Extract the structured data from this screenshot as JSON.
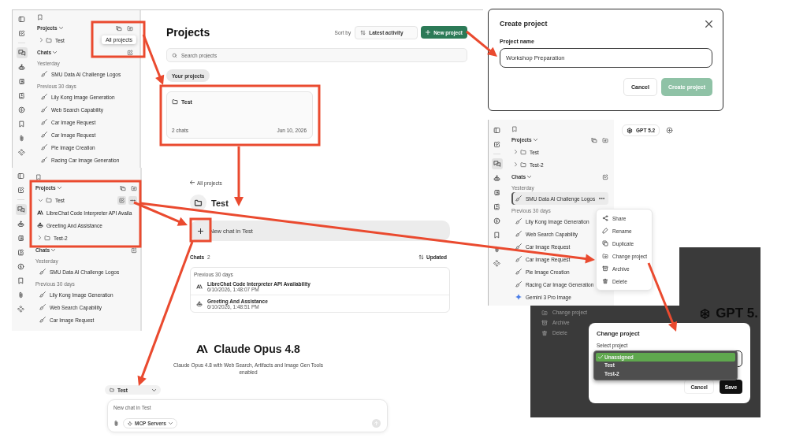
{
  "projects_page": {
    "sidebar": {
      "rail": [
        {
          "kind": "panel",
          "selected": false
        },
        {
          "kind": "compose",
          "selected": false
        },
        {
          "kind": "chats",
          "selected": true
        },
        {
          "kind": "agents",
          "selected": false
        },
        {
          "kind": "prompts",
          "selected": false
        },
        {
          "kind": "memories",
          "selected": false
        },
        {
          "kind": "bolt",
          "selected": false
        },
        {
          "kind": "bookmarks",
          "selected": false
        },
        {
          "kind": "files",
          "selected": false
        },
        {
          "kind": "mcp",
          "selected": false
        }
      ],
      "projects_label": "Projects",
      "tooltip": "All projects",
      "projects": [
        {
          "name": "Test",
          "expanded": false,
          "hovered": false
        }
      ],
      "chats_label": "Chats",
      "chat_groups": [
        {
          "label": "Yesterday",
          "chats": [
            {
              "title": "SMU Data AI Challenge Logos",
              "kind": "brush",
              "selected": false
            }
          ]
        },
        {
          "label": "Previous 30 days",
          "chats": [
            {
              "title": "Lily Kong Image Generation",
              "kind": "brush",
              "selected": false
            },
            {
              "title": "Web Search Capability",
              "kind": "brush",
              "selected": false
            },
            {
              "title": "Car Image Request",
              "kind": "brush",
              "selected": false
            },
            {
              "title": "Car Image Request",
              "kind": "brush",
              "selected": false
            },
            {
              "title": "Pie Image Creation",
              "kind": "brush",
              "selected": false
            },
            {
              "title": "Racing Car Image Generation",
              "kind": "brush",
              "selected": false
            }
          ]
        }
      ]
    },
    "main": {
      "title": "Projects",
      "sort_label": "Sort by",
      "sort_value": "Latest activity",
      "new_button": "New project",
      "search": {
        "placeholder": "Search projects"
      },
      "filters": [
        {
          "label": "Your projects",
          "selected": true
        }
      ],
      "cards": [
        {
          "name": "Test",
          "count": "2 chats",
          "date": "Jun 10, 2026"
        }
      ]
    }
  },
  "create_project_dialog": {
    "title": "Create project",
    "field_label": "Project name",
    "field_value": "Workshop Preparation",
    "buttons": [
      {
        "label": "Cancel",
        "kind": "secondary",
        "disabled": false
      },
      {
        "label": "Create project",
        "kind": "primary",
        "disabled": true
      }
    ]
  },
  "project_sidebar": {
    "rail": [
      {
        "kind": "panel",
        "selected": false
      },
      {
        "kind": "compose",
        "selected": false
      },
      {
        "kind": "chats",
        "selected": true
      },
      {
        "kind": "agents",
        "selected": false
      },
      {
        "kind": "prompts",
        "selected": false
      },
      {
        "kind": "memories",
        "selected": false
      },
      {
        "kind": "bolt",
        "selected": false
      },
      {
        "kind": "bookmarks",
        "selected": false
      },
      {
        "kind": "files",
        "selected": false
      },
      {
        "kind": "mcp",
        "selected": false
      }
    ],
    "projects_label": "Projects",
    "projects": [
      {
        "name": "Test",
        "expanded": true,
        "hovered": true,
        "children": [
          {
            "title": "LibreChat Code Interpreter API Availa",
            "kind": "anthropic"
          },
          {
            "title": "Greeting And Assistance",
            "kind": "bot"
          }
        ]
      },
      {
        "name": "Test-2",
        "expanded": false,
        "hovered": false
      }
    ],
    "chats_label": "Chats",
    "chat_groups": [
      {
        "label": "Yesterday",
        "chats": [
          {
            "title": "SMU Data AI Challenge Logos",
            "kind": "brush",
            "selected": false
          }
        ]
      },
      {
        "label": "Previous 30 days",
        "chats": [
          {
            "title": "Lily Kong Image Generation",
            "kind": "brush",
            "selected": false
          },
          {
            "title": "Web Search Capability",
            "kind": "brush",
            "selected": false
          },
          {
            "title": "Car Image Request",
            "kind": "brush",
            "selected": false
          }
        ]
      }
    ]
  },
  "project_page": {
    "back_link": "All projects",
    "title": "Test",
    "new_chat": "New chat in Test",
    "chats_label": "Chats",
    "chats_count": "2",
    "sort_label": "Updated",
    "group_label": "Previous 30 days",
    "chats": [
      {
        "title": "LibreChat Code Interpreter API Availability",
        "time": "6/10/2026, 1:48:07 PM",
        "kind": "anthropic"
      },
      {
        "title": "Greeting And Assistance",
        "time": "6/10/2026, 1:48:51 PM",
        "kind": "bot"
      }
    ]
  },
  "new_chat_page": {
    "model": "Claude Opus 4.8",
    "description": "Claude Opus 4.8 with Web Search, Artifacts and Image Gen Tools enabled",
    "project": "Test",
    "input": {
      "placeholder": "New chat in Test"
    },
    "tools": [
      {
        "label": "MCP Servers"
      }
    ]
  },
  "chat_page": {
    "sidebar": {
      "rail": [
        {
          "kind": "panel",
          "selected": false
        },
        {
          "kind": "compose",
          "selected": false
        },
        {
          "kind": "chats",
          "selected": true
        },
        {
          "kind": "agents",
          "selected": false
        },
        {
          "kind": "prompts",
          "selected": false
        },
        {
          "kind": "memories",
          "selected": false
        },
        {
          "kind": "bolt",
          "selected": false
        },
        {
          "kind": "bookmarks",
          "selected": false
        },
        {
          "kind": "files",
          "selected": false
        },
        {
          "kind": "mcp",
          "selected": false
        }
      ],
      "projects_label": "Projects",
      "projects": [
        {
          "name": "Test",
          "expanded": false,
          "hovered": false
        },
        {
          "name": "Test-2",
          "expanded": false,
          "hovered": false
        }
      ],
      "chats_label": "Chats",
      "chat_groups": [
        {
          "label": "Yesterday",
          "chats": [
            {
              "title": "SMU Data AI Challenge Logos",
              "kind": "brush",
              "selected": true
            }
          ]
        },
        {
          "label": "Previous 30 days",
          "chats": [
            {
              "title": "Lily Kong Image Generation",
              "kind": "brush",
              "selected": false
            },
            {
              "title": "Web Search Capability",
              "kind": "brush",
              "selected": false
            },
            {
              "title": "Car Image Request",
              "kind": "brush",
              "selected": false
            },
            {
              "title": "Car Image Request",
              "kind": "brush",
              "selected": false
            },
            {
              "title": "Pie Image Creation",
              "kind": "brush",
              "selected": false
            },
            {
              "title": "Racing Car Image Generation",
              "kind": "brush",
              "selected": false
            },
            {
              "title": "Gemini 3 Pro Image",
              "kind": "gemini",
              "selected": false
            }
          ]
        }
      ]
    },
    "model_button": "GPT 5.2",
    "context_menu": [
      {
        "label": "Share",
        "kind": "share"
      },
      {
        "label": "Rename",
        "kind": "rename"
      },
      {
        "label": "Duplicate",
        "kind": "duplicate"
      },
      {
        "label": "Change project",
        "kind": "move"
      },
      {
        "label": "Archive",
        "kind": "archive"
      },
      {
        "label": "Delete",
        "kind": "delete"
      }
    ]
  },
  "change_project_dialog": {
    "background": {
      "menu": [
        {
          "label": "Change project",
          "kind": "move"
        },
        {
          "label": "Archive",
          "kind": "archive"
        },
        {
          "label": "Delete",
          "kind": "delete"
        }
      ],
      "model": "GPT 5."
    },
    "title": "Change project",
    "field_label": "Select project",
    "options": [
      {
        "label": "Unassigned",
        "selected": true
      },
      {
        "label": "Test",
        "selected": false
      },
      {
        "label": "Test-2",
        "selected": false
      }
    ],
    "buttons": [
      {
        "label": "Cancel",
        "kind": "secondary"
      },
      {
        "label": "Save",
        "kind": "primary"
      }
    ]
  }
}
